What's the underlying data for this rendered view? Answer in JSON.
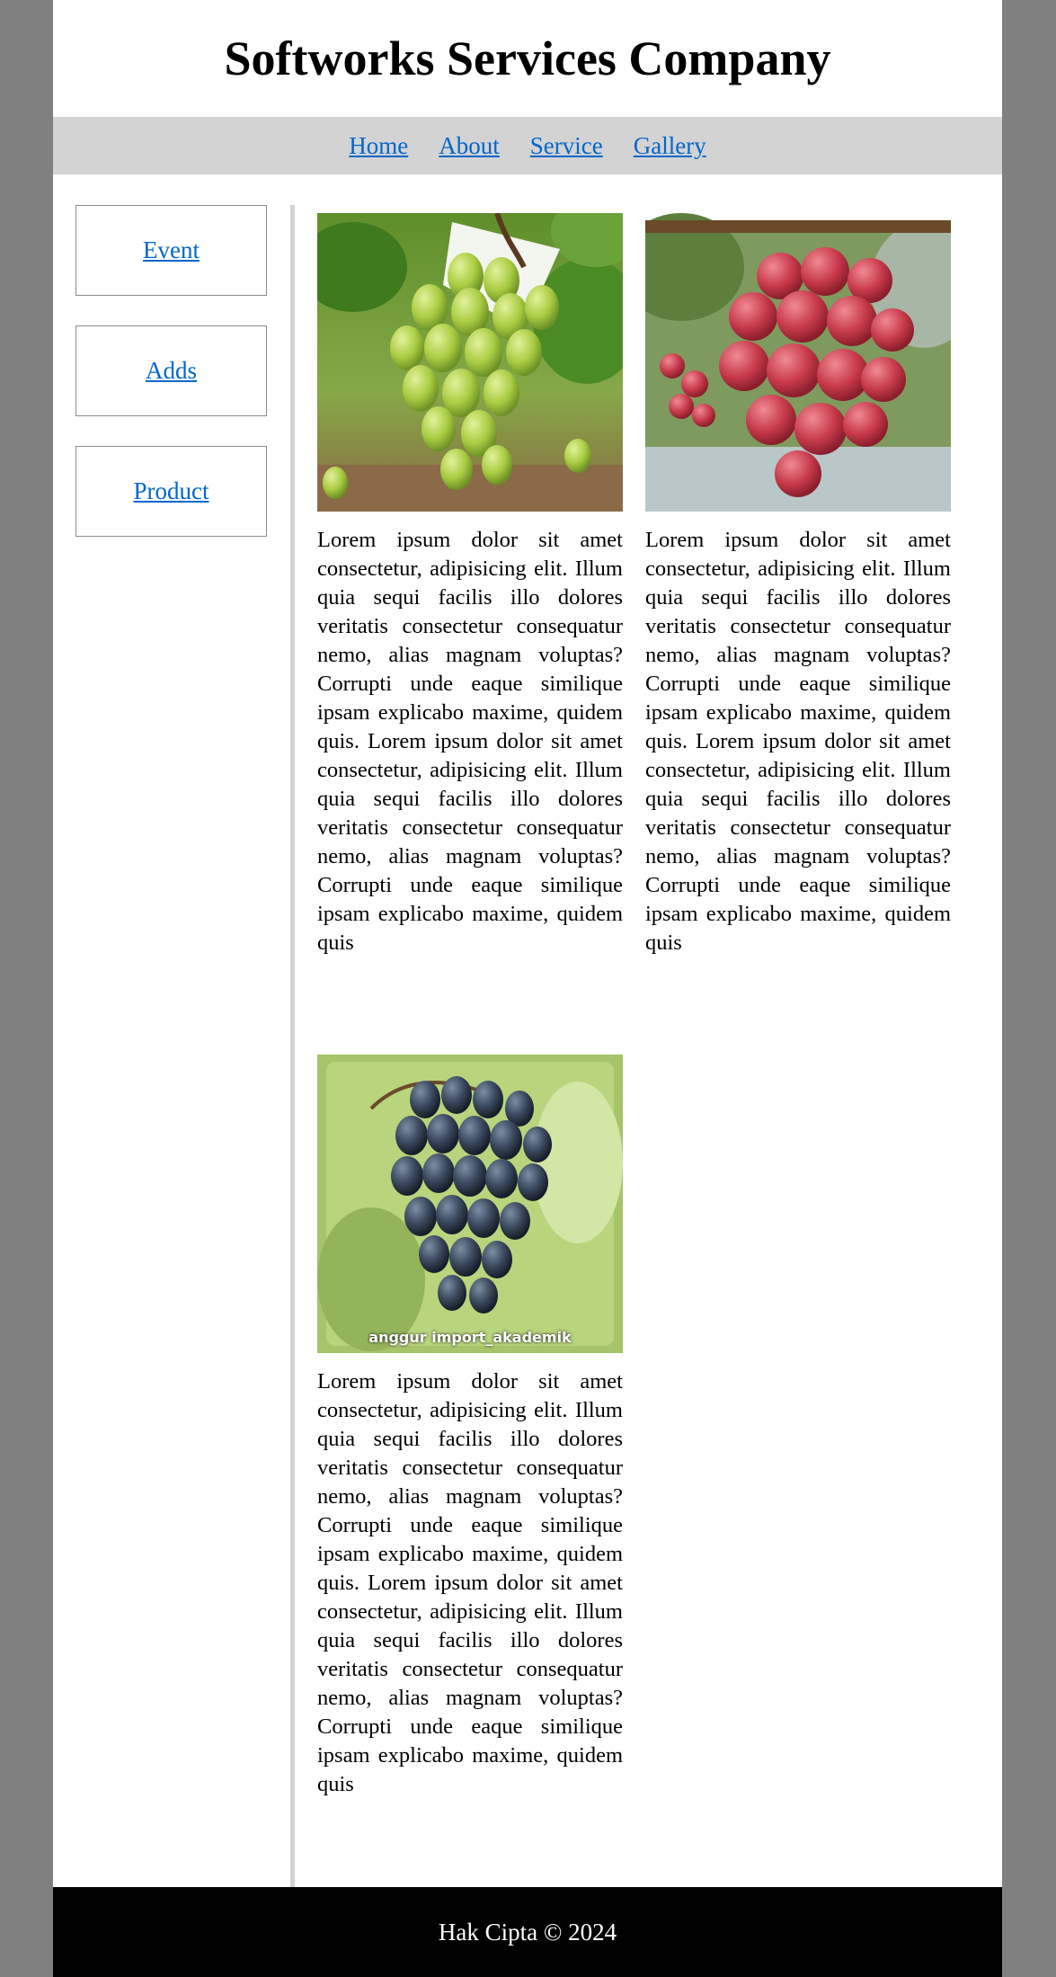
{
  "header": {
    "title": "Softworks Services Company"
  },
  "nav": {
    "items": [
      "Home",
      "About",
      "Service",
      "Gallery"
    ]
  },
  "sidebar": {
    "items": [
      "Event",
      "Adds",
      "Product"
    ]
  },
  "gallery": {
    "items": [
      {
        "image": "green-grapes-photo",
        "text": "Lorem ipsum dolor sit amet consectetur, adipisicing elit. Illum quia sequi facilis illo dolores veritatis consectetur consequatur nemo, alias magnam voluptas? Corrupti unde eaque similique ipsam explicabo maxime, quidem quis. Lorem ipsum dolor sit amet consectetur, adipisicing elit. Illum quia sequi facilis illo dolores veritatis consectetur consequatur nemo, alias magnam voluptas? Corrupti unde eaque similique ipsam explicabo maxime, quidem quis"
      },
      {
        "image": "red-grapes-photo",
        "text": "Lorem ipsum dolor sit amet consectetur, adipisicing elit. Illum quia sequi facilis illo dolores veritatis consectetur consequatur nemo, alias magnam voluptas? Corrupti unde eaque similique ipsam explicabo maxime, quidem quis. Lorem ipsum dolor sit amet consectetur, adipisicing elit. Illum quia sequi facilis illo dolores veritatis consectetur consequatur nemo, alias magnam voluptas? Corrupti unde eaque similique ipsam explicabo maxime, quidem quis"
      },
      {
        "image": "black-grapes-photo",
        "caption": "anggur import_akademik",
        "text": "Lorem ipsum dolor sit amet consectetur, adipisicing elit. Illum quia sequi facilis illo dolores veritatis consectetur consequatur nemo, alias magnam voluptas? Corrupti unde eaque similique ipsam explicabo maxime, quidem quis. Lorem ipsum dolor sit amet consectetur, adipisicing elit. Illum quia sequi facilis illo dolores veritatis consectetur consequatur nemo, alias magnam voluptas? Corrupti unde eaque similique ipsam explicabo maxime, quidem quis"
      }
    ]
  },
  "footer": {
    "text": "Hak Cipta © 2024"
  },
  "colors": {
    "background": "#808080",
    "nav_background": "#d3d3d3",
    "link": "#0066cc",
    "footer_background": "#000000"
  }
}
